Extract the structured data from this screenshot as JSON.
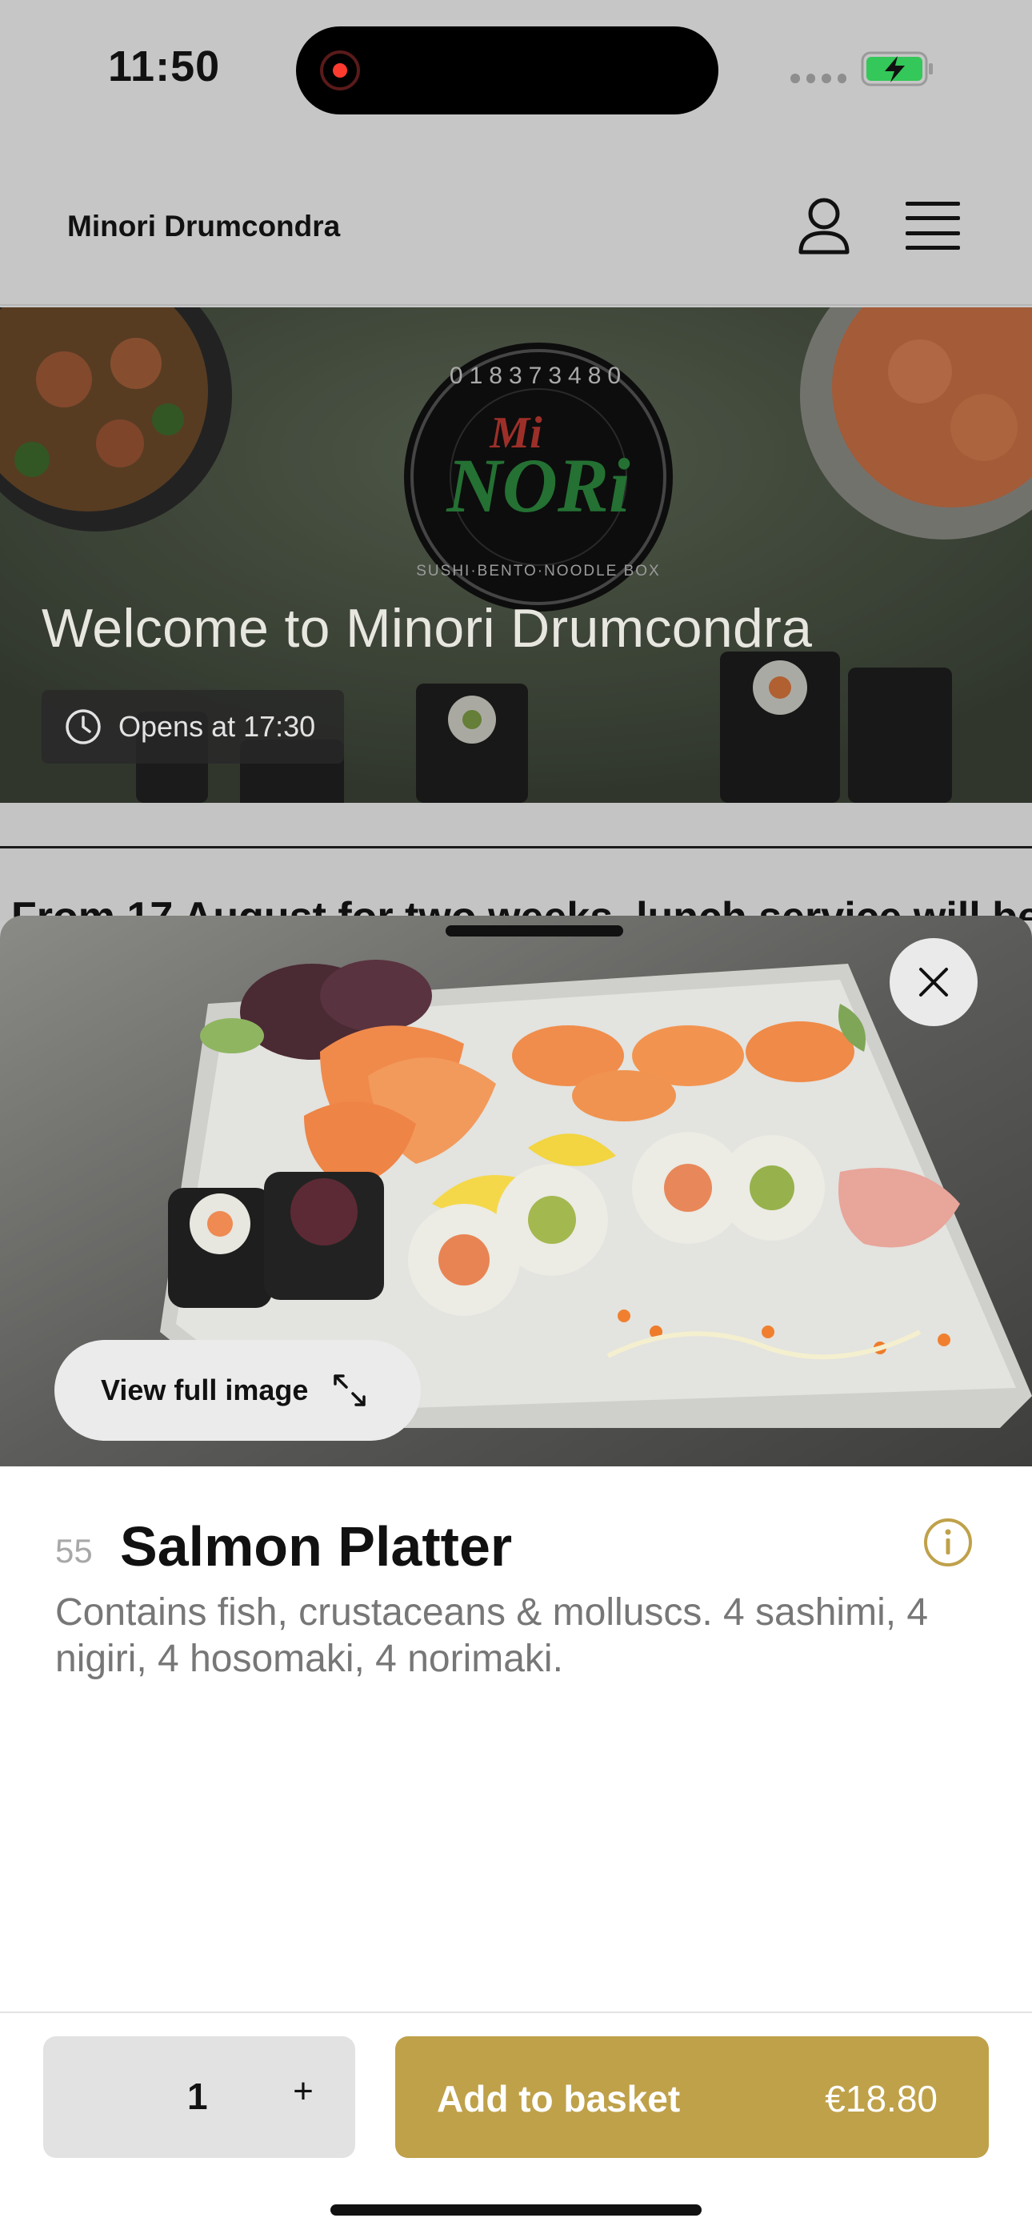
{
  "status_bar": {
    "time": "11:50"
  },
  "header": {
    "brand": "Minori Drumcondra"
  },
  "hero": {
    "logo_number": "018373480",
    "logo_word_top": "Mi",
    "logo_word_main": "NORi",
    "logo_tagline": "SUSHI·BENTO·NOODLE BOX",
    "title": "Welcome to Minori Drumcondra",
    "hours": "Opens at 17:30"
  },
  "notice": {
    "text": "From 17 August for two weeks, lunch service will be"
  },
  "product": {
    "view_full_image": "View full image",
    "number": "55",
    "name": "Salmon Platter",
    "description": "Contains fish, crustaceans & molluscs. 4 sashimi, 4 nigiri, 4 hosomaki, 4 norimaki."
  },
  "footer": {
    "quantity": "1",
    "plus": "+",
    "add_label": "Add to basket",
    "price": "€18.80"
  },
  "colors": {
    "accent": "#bfa14a",
    "rec": "#ff3b30",
    "battery": "#34c759"
  },
  "icons": [
    "record-icon",
    "battery-icon",
    "account-icon",
    "menu-icon",
    "clock-icon",
    "close-icon",
    "expand-icon",
    "info-icon"
  ]
}
